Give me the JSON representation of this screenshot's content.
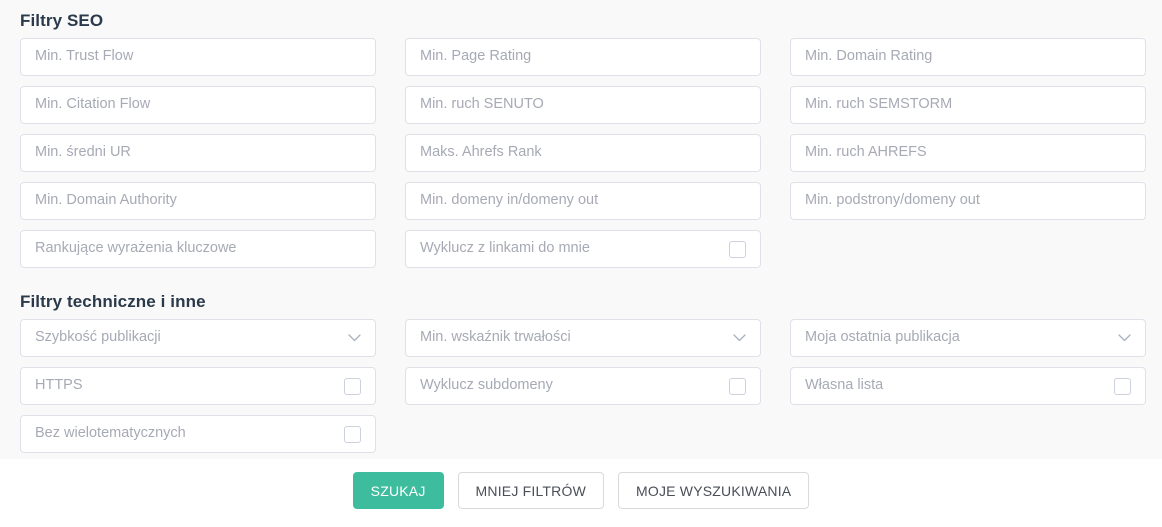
{
  "sections": {
    "seo": {
      "title": "Filtry SEO",
      "fields": [
        {
          "label": "Min. Trust Flow",
          "type": "text",
          "name": "min-trust-flow"
        },
        {
          "label": "Min. Page Rating",
          "type": "text",
          "name": "min-page-rating"
        },
        {
          "label": "Min. Domain Rating",
          "type": "text",
          "name": "min-domain-rating"
        },
        {
          "label": "Min. Citation Flow",
          "type": "text",
          "name": "min-citation-flow"
        },
        {
          "label": "Min. ruch SENUTO",
          "type": "text",
          "name": "min-ruch-senuto"
        },
        {
          "label": "Min. ruch SEMSTORM",
          "type": "text",
          "name": "min-ruch-semstorm"
        },
        {
          "label": "Min. średni UR",
          "type": "text",
          "name": "min-sredni-ur"
        },
        {
          "label": "Maks. Ahrefs Rank",
          "type": "text",
          "name": "maks-ahrefs-rank"
        },
        {
          "label": "Min. ruch AHREFS",
          "type": "text",
          "name": "min-ruch-ahrefs"
        },
        {
          "label": "Min. Domain Authority",
          "type": "text",
          "name": "min-domain-authority"
        },
        {
          "label": "Min. domeny in/domeny out",
          "type": "text",
          "name": "min-domeny-in-domeny-out"
        },
        {
          "label": "Min. podstrony/domeny out",
          "type": "text",
          "name": "min-podstrony-domeny-out"
        },
        {
          "label": "Rankujące wyrażenia kluczowe",
          "type": "text",
          "name": "rankujace-wyrazenia-kluczowe"
        },
        {
          "label": "Wyklucz z linkami do mnie",
          "type": "checkbox",
          "name": "wyklucz-z-linkami-do-mnie",
          "checked": false
        },
        {
          "label": "",
          "type": "empty",
          "name": "empty-slot"
        }
      ]
    },
    "technical": {
      "title": "Filtry techniczne i inne",
      "fields": [
        {
          "label": "Szybkość publikacji",
          "type": "select",
          "name": "szybkosc-publikacji"
        },
        {
          "label": "Min. wskaźnik trwałości",
          "type": "select",
          "name": "min-wskaznik-trwalosci"
        },
        {
          "label": "Moja ostatnia publikacja",
          "type": "select",
          "name": "moja-ostatnia-publikacja"
        },
        {
          "label": "HTTPS",
          "type": "checkbox",
          "name": "https",
          "checked": false
        },
        {
          "label": "Wyklucz subdomeny",
          "type": "checkbox",
          "name": "wyklucz-subdomeny",
          "checked": false
        },
        {
          "label": "Własna lista",
          "type": "checkbox",
          "name": "wlasna-lista",
          "checked": false
        },
        {
          "label": "Bez wielotematycznych",
          "type": "checkbox",
          "name": "bez-wielotematycznych",
          "checked": false
        },
        {
          "label": "",
          "type": "empty",
          "name": "empty-slot"
        },
        {
          "label": "",
          "type": "empty",
          "name": "empty-slot"
        }
      ]
    }
  },
  "buttons": [
    {
      "label": "SZUKAJ",
      "name": "search-button",
      "style": "primary"
    },
    {
      "label": "MNIEJ FILTRÓW",
      "name": "fewer-filters-button",
      "style": "default"
    },
    {
      "label": "MOJE WYSZUKIWANIA",
      "name": "my-searches-button",
      "style": "default"
    }
  ],
  "icons": {
    "chevron": "chevron-down-icon",
    "checkbox": "checkbox-icon"
  },
  "colors": {
    "accent": "#3dbd9d",
    "panel_bg": "#f9f9fa",
    "field_border": "#dfe1e8",
    "placeholder": "#a7aab5",
    "heading": "#2b3a4a"
  }
}
